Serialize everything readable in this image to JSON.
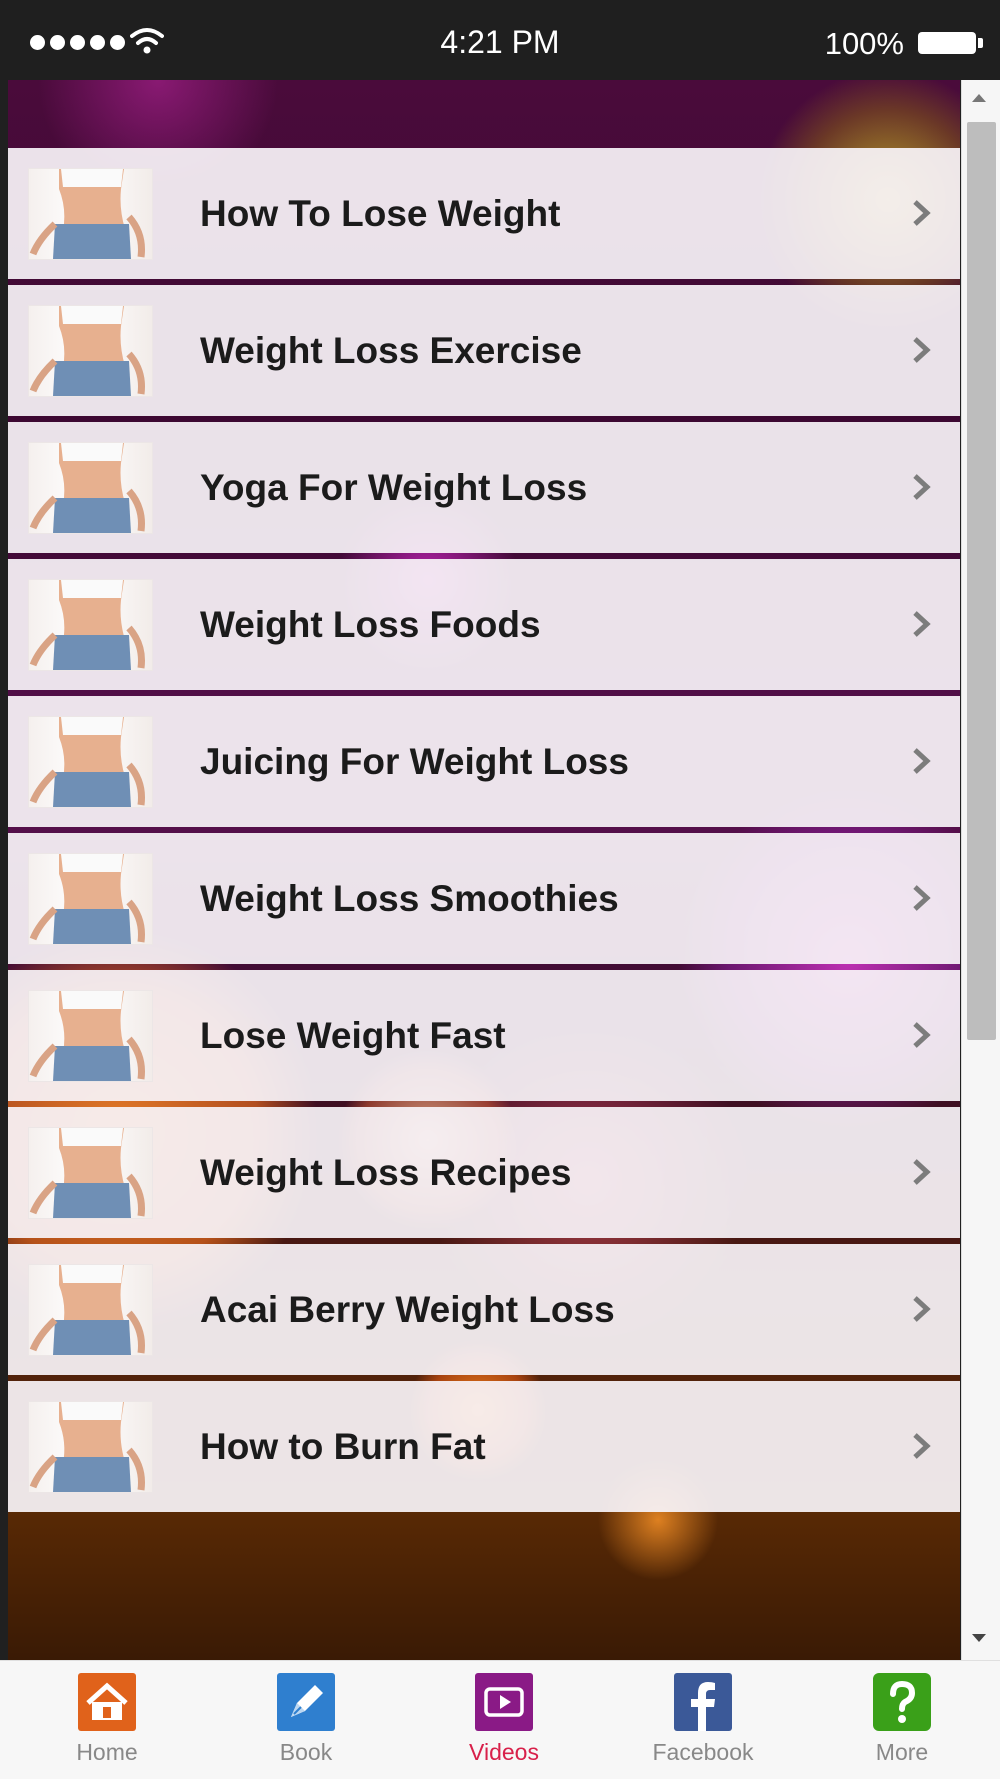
{
  "status_bar": {
    "time": "4:21 PM",
    "battery": "100%"
  },
  "menu": {
    "items": [
      {
        "label": "How To Lose Weight"
      },
      {
        "label": "Weight Loss Exercise"
      },
      {
        "label": "Yoga For Weight Loss"
      },
      {
        "label": "Weight Loss Foods"
      },
      {
        "label": "Juicing For Weight Loss"
      },
      {
        "label": "Weight Loss Smoothies"
      },
      {
        "label": "Lose Weight Fast"
      },
      {
        "label": "Weight Loss Recipes"
      },
      {
        "label": "Acai Berry Weight Loss"
      },
      {
        "label": "How to Burn Fat"
      }
    ]
  },
  "tabbar": {
    "active": "Videos",
    "tabs": [
      {
        "label": "Home",
        "icon": "home-icon",
        "color": "#e0621b"
      },
      {
        "label": "Book",
        "icon": "pen-icon",
        "color": "#2f7fcf"
      },
      {
        "label": "Videos",
        "icon": "play-icon",
        "color": "#8a1a86"
      },
      {
        "label": "Facebook",
        "icon": "facebook-icon",
        "color": "#3b5998"
      },
      {
        "label": "More",
        "icon": "question-icon",
        "color": "#3aa019"
      }
    ]
  }
}
